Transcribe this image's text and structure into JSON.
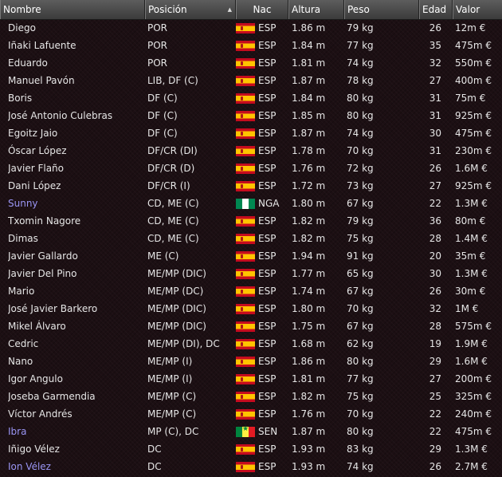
{
  "columns": {
    "name": "Nombre",
    "position": "Posición",
    "nationality": "Nac",
    "height": "Altura",
    "weight": "Peso",
    "age": "Edad",
    "value": "Valor",
    "sorted_column": "position",
    "sort_icon": "triangle-up-icon"
  },
  "colors": {
    "header_bg": "#4a4a4a",
    "row_bg": "#1c0f13",
    "text": "#e6e6e6",
    "highlight_name": "#9a95f4"
  },
  "players": [
    {
      "name": "Diego",
      "position": "POR",
      "flag": "spain-flag-icon",
      "nation": "ESP",
      "height": "1.86 m",
      "weight": "79 kg",
      "age": "26",
      "value": "12m €",
      "highlighted": false
    },
    {
      "name": "Iñaki Lafuente",
      "position": "POR",
      "flag": "spain-flag-icon",
      "nation": "ESP",
      "height": "1.84 m",
      "weight": "77 kg",
      "age": "35",
      "value": "475m €",
      "highlighted": false
    },
    {
      "name": "Eduardo",
      "position": "POR",
      "flag": "spain-flag-icon",
      "nation": "ESP",
      "height": "1.81 m",
      "weight": "74 kg",
      "age": "32",
      "value": "550m €",
      "highlighted": false
    },
    {
      "name": "Manuel Pavón",
      "position": "LIB, DF (C)",
      "flag": "spain-flag-icon",
      "nation": "ESP",
      "height": "1.87 m",
      "weight": "78 kg",
      "age": "27",
      "value": "400m €",
      "highlighted": false
    },
    {
      "name": "Boris",
      "position": "DF (C)",
      "flag": "spain-flag-icon",
      "nation": "ESP",
      "height": "1.84 m",
      "weight": "80 kg",
      "age": "31",
      "value": "75m €",
      "highlighted": false
    },
    {
      "name": "José Antonio Culebras",
      "position": "DF (C)",
      "flag": "spain-flag-icon",
      "nation": "ESP",
      "height": "1.85 m",
      "weight": "80 kg",
      "age": "31",
      "value": "925m €",
      "highlighted": false
    },
    {
      "name": "Egoitz Jaio",
      "position": "DF (C)",
      "flag": "spain-flag-icon",
      "nation": "ESP",
      "height": "1.87 m",
      "weight": "74 kg",
      "age": "30",
      "value": "475m €",
      "highlighted": false
    },
    {
      "name": "Óscar López",
      "position": "DF/CR (DI)",
      "flag": "spain-flag-icon",
      "nation": "ESP",
      "height": "1.78 m",
      "weight": "70 kg",
      "age": "31",
      "value": "230m €",
      "highlighted": false
    },
    {
      "name": "Javier Flaño",
      "position": "DF/CR (D)",
      "flag": "spain-flag-icon",
      "nation": "ESP",
      "height": "1.76 m",
      "weight": "72 kg",
      "age": "26",
      "value": "1.6M €",
      "highlighted": false
    },
    {
      "name": "Dani López",
      "position": "DF/CR (I)",
      "flag": "spain-flag-icon",
      "nation": "ESP",
      "height": "1.72 m",
      "weight": "73 kg",
      "age": "27",
      "value": "925m €",
      "highlighted": false
    },
    {
      "name": "Sunny",
      "position": "CD, ME (C)",
      "flag": "nigeria-flag-icon",
      "nation": "NGA",
      "height": "1.80 m",
      "weight": "67 kg",
      "age": "22",
      "value": "1.3M €",
      "highlighted": true
    },
    {
      "name": "Txomin Nagore",
      "position": "CD, ME (C)",
      "flag": "spain-flag-icon",
      "nation": "ESP",
      "height": "1.82 m",
      "weight": "79 kg",
      "age": "36",
      "value": "80m €",
      "highlighted": false
    },
    {
      "name": "Dimas",
      "position": "CD, ME (C)",
      "flag": "spain-flag-icon",
      "nation": "ESP",
      "height": "1.82 m",
      "weight": "75 kg",
      "age": "28",
      "value": "1.4M €",
      "highlighted": false
    },
    {
      "name": "Javier Gallardo",
      "position": "ME (C)",
      "flag": "spain-flag-icon",
      "nation": "ESP",
      "height": "1.94 m",
      "weight": "91 kg",
      "age": "20",
      "value": "35m €",
      "highlighted": false
    },
    {
      "name": "Javier Del Pino",
      "position": "ME/MP (DIC)",
      "flag": "spain-flag-icon",
      "nation": "ESP",
      "height": "1.77 m",
      "weight": "65 kg",
      "age": "30",
      "value": "1.3M €",
      "highlighted": false
    },
    {
      "name": "Mario",
      "position": "ME/MP (DC)",
      "flag": "spain-flag-icon",
      "nation": "ESP",
      "height": "1.74 m",
      "weight": "67 kg",
      "age": "26",
      "value": "30m €",
      "highlighted": false
    },
    {
      "name": "José Javier Barkero",
      "position": "ME/MP (DIC)",
      "flag": "spain-flag-icon",
      "nation": "ESP",
      "height": "1.80 m",
      "weight": "70 kg",
      "age": "32",
      "value": "1M €",
      "highlighted": false
    },
    {
      "name": "Mikel Álvaro",
      "position": "ME/MP (DIC)",
      "flag": "spain-flag-icon",
      "nation": "ESP",
      "height": "1.75 m",
      "weight": "67 kg",
      "age": "28",
      "value": "575m €",
      "highlighted": false
    },
    {
      "name": "Cedric",
      "position": "ME/MP (DI), DC",
      "flag": "spain-flag-icon",
      "nation": "ESP",
      "height": "1.68 m",
      "weight": "62 kg",
      "age": "19",
      "value": "1.9M €",
      "highlighted": false
    },
    {
      "name": "Nano",
      "position": "ME/MP (I)",
      "flag": "spain-flag-icon",
      "nation": "ESP",
      "height": "1.86 m",
      "weight": "80 kg",
      "age": "29",
      "value": "1.6M €",
      "highlighted": false
    },
    {
      "name": "Igor Angulo",
      "position": "ME/MP (I)",
      "flag": "spain-flag-icon",
      "nation": "ESP",
      "height": "1.81 m",
      "weight": "77 kg",
      "age": "27",
      "value": "200m €",
      "highlighted": false
    },
    {
      "name": "Joseba Garmendia",
      "position": "ME/MP (C)",
      "flag": "spain-flag-icon",
      "nation": "ESP",
      "height": "1.82 m",
      "weight": "75 kg",
      "age": "25",
      "value": "325m €",
      "highlighted": false
    },
    {
      "name": "Víctor Andrés",
      "position": "ME/MP (C)",
      "flag": "spain-flag-icon",
      "nation": "ESP",
      "height": "1.76 m",
      "weight": "70 kg",
      "age": "22",
      "value": "240m €",
      "highlighted": false
    },
    {
      "name": "Ibra",
      "position": "MP (C), DC",
      "flag": "senegal-flag-icon",
      "nation": "SEN",
      "height": "1.87 m",
      "weight": "80 kg",
      "age": "22",
      "value": "475m €",
      "highlighted": true
    },
    {
      "name": "Iñigo Vélez",
      "position": "DC",
      "flag": "spain-flag-icon",
      "nation": "ESP",
      "height": "1.93 m",
      "weight": "83 kg",
      "age": "29",
      "value": "1.3M €",
      "highlighted": false
    },
    {
      "name": "Ion Vélez",
      "position": "DC",
      "flag": "spain-flag-icon",
      "nation": "ESP",
      "height": "1.93 m",
      "weight": "74 kg",
      "age": "26",
      "value": "2.7M €",
      "highlighted": true
    }
  ]
}
